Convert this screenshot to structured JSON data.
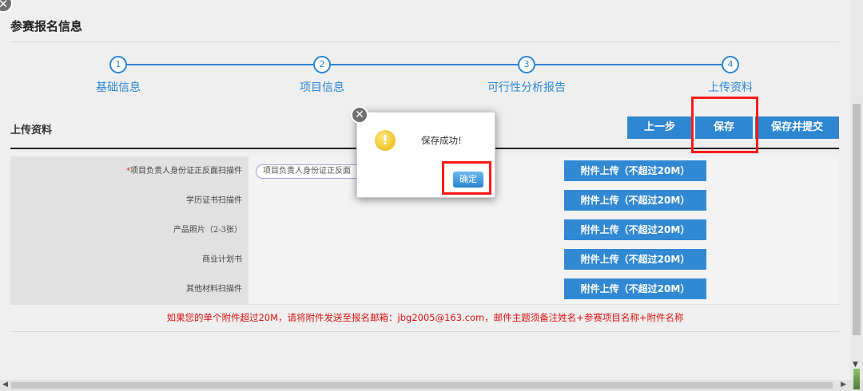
{
  "page": {
    "title": "参赛报名信息",
    "close_glyph": "✕"
  },
  "steps": [
    {
      "num": "1",
      "label": "基础信息"
    },
    {
      "num": "2",
      "label": "项目信息"
    },
    {
      "num": "3",
      "label": "可行性分析报告"
    },
    {
      "num": "4",
      "label": "上传资料"
    }
  ],
  "section": {
    "title": "上传资料",
    "prev_label": "上一步",
    "save_label": "保存",
    "save_submit_label": "保存并提交"
  },
  "rows": [
    {
      "required_mark": "*",
      "label": "项目负责人身份证正反面扫描件",
      "file_name": "项目负责人身份证正反面",
      "upload_label": "附件上传（不超过20M）"
    },
    {
      "label": "学历证书扫描件",
      "upload_label": "附件上传（不超过20M）"
    },
    {
      "label": "产品照片（2-3张）",
      "upload_label": "附件上传（不超过20M）"
    },
    {
      "label": "商业计划书",
      "upload_label": "附件上传（不超过20M）"
    },
    {
      "label": "其他材料扫描件",
      "upload_label": "附件上传（不超过20M）"
    }
  ],
  "notice": "如果您的单个附件超过20M，请将附件发送至报名邮箱：jbg2005@163.com，邮件主题须备注姓名+参赛项目名称+附件名称",
  "dialog": {
    "close_glyph": "✕",
    "icon_glyph": "!",
    "message": "保存成功!",
    "ok_label": "确定"
  },
  "colors": {
    "accent": "#2f86d0",
    "highlight": "#ff1a1a",
    "notice": "#d11111"
  }
}
